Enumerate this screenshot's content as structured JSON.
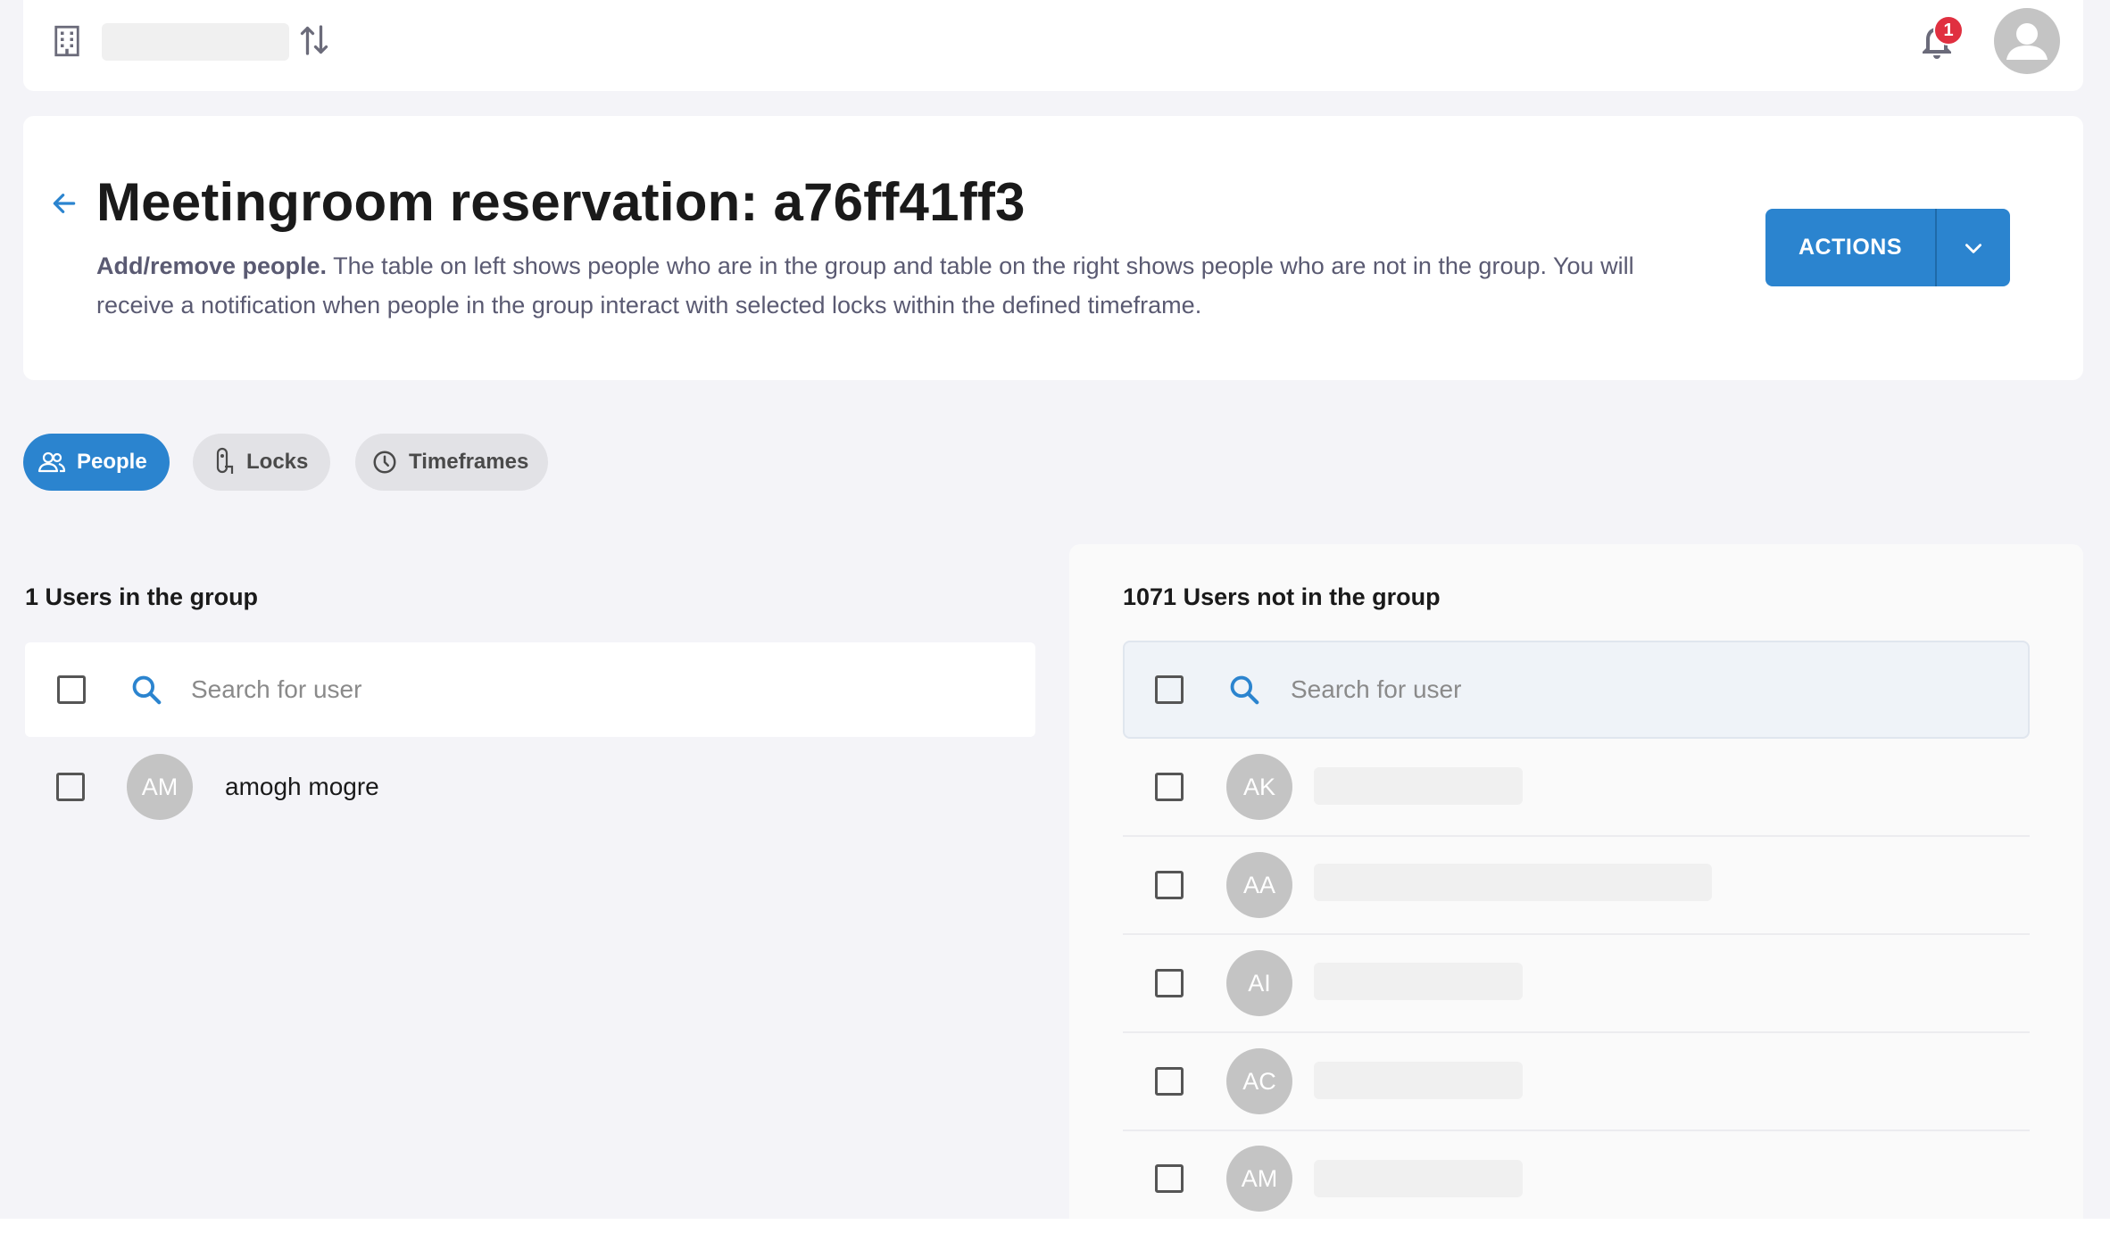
{
  "topbar": {
    "notification_count": "1"
  },
  "header": {
    "title": "Meetingroom reservation: a76ff41ff3",
    "description_bold": "Add/remove people.",
    "description_rest": " The table on left shows people who are in the group and table on the right shows people who are not in the group. You will receive a notification when people in the group interact with selected locks within the defined timeframe.",
    "actions_label": "ACTIONS"
  },
  "tabs": [
    {
      "label": "People",
      "icon": "people-icon",
      "active": true
    },
    {
      "label": "Locks",
      "icon": "lock-icon",
      "active": false
    },
    {
      "label": "Timeframes",
      "icon": "clock-icon",
      "active": false
    }
  ],
  "left_panel": {
    "title": "1 Users in the group",
    "search_placeholder": "Search for user",
    "users": [
      {
        "initials": "AM",
        "name": "amogh mogre"
      }
    ]
  },
  "right_panel": {
    "title": "1071 Users not in the group",
    "search_placeholder": "Search for user",
    "users": [
      {
        "initials": "AK"
      },
      {
        "initials": "AA"
      },
      {
        "initials": "AI"
      },
      {
        "initials": "AC"
      },
      {
        "initials": "AM"
      }
    ]
  },
  "colors": {
    "accent": "#2b84cf",
    "badge": "#e03040",
    "avatar": "#c4c4c4",
    "background": "#f4f4f8"
  }
}
